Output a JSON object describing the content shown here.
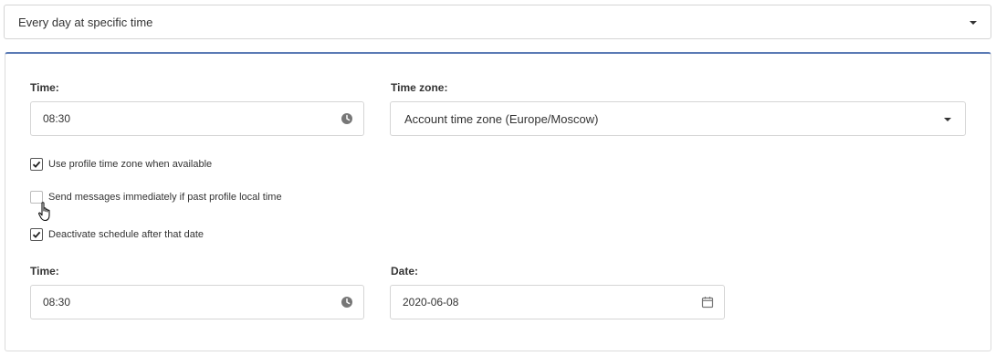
{
  "schedule": {
    "frequency_value": "Every day at specific time"
  },
  "settings": {
    "time_label": "Time:",
    "time_value": "08:30",
    "timezone_label": "Time zone:",
    "timezone_value": "Account time zone (Europe/Moscow)",
    "checkboxes": [
      {
        "label": "Use profile time zone when available",
        "checked": true
      },
      {
        "label": "Send messages immediately if past profile local time",
        "checked": false
      },
      {
        "label": "Deactivate schedule after that date",
        "checked": true
      }
    ],
    "end_time_label": "Time:",
    "end_time_value": "08:30",
    "end_date_label": "Date:",
    "end_date_value": "2020-06-08"
  },
  "icons": {
    "clock": "clock-icon",
    "calendar": "calendar-icon",
    "dropdown": "chevron-down-icon",
    "check": "check-icon",
    "cursor": "hand-pointer-icon"
  },
  "colors": {
    "panel_top_border": "#5b7bb5",
    "input_border": "#d5d5d5",
    "icon": "#777777"
  }
}
